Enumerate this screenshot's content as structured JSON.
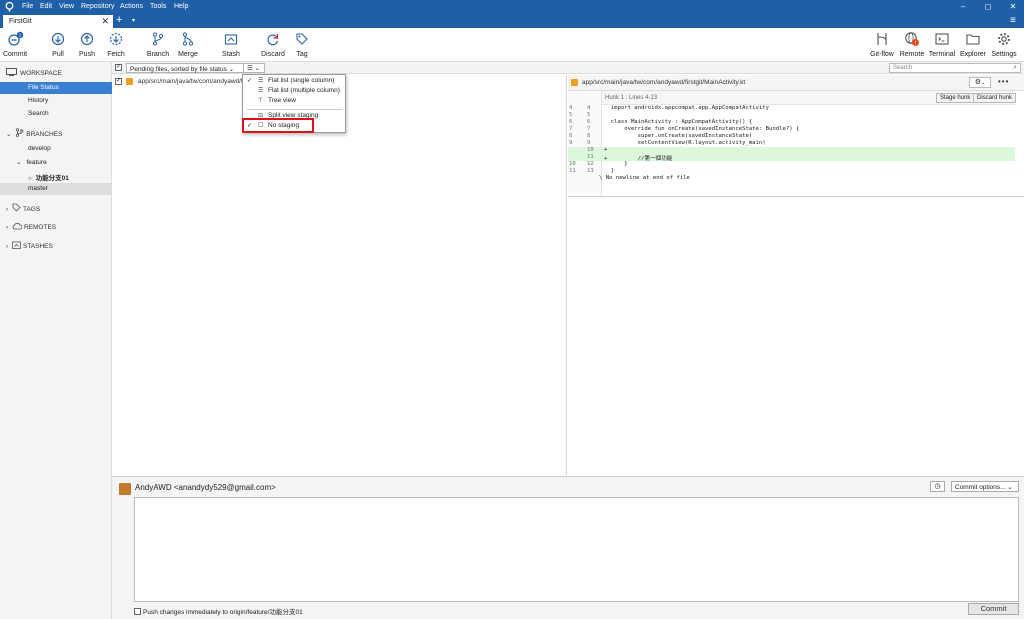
{
  "menubar": {
    "items": [
      "File",
      "Edit",
      "View",
      "Repository",
      "Actions",
      "Tools",
      "Help"
    ],
    "window_controls": [
      "–",
      "◻",
      "✕"
    ]
  },
  "tabs": {
    "active": "FirstGit",
    "close": "✕",
    "new": "+",
    "dropdown": "▾",
    "hamburger": "≡"
  },
  "toolbar": {
    "commit": "Commit",
    "commit_badge": "1",
    "pull": "Pull",
    "push": "Push",
    "fetch": "Fetch",
    "branch": "Branch",
    "merge": "Merge",
    "stash": "Stash",
    "discard": "Discard",
    "tag": "Tag",
    "gitflow": "Git-flow",
    "remote": "Remote",
    "remote_badge": "!",
    "terminal": "Terminal",
    "explorer": "Explorer",
    "settings": "Settings"
  },
  "search": {
    "placeholder": "Search"
  },
  "sidebar": {
    "workspace": "WORKSPACE",
    "file_status": "File Status",
    "history": "History",
    "search": "Search",
    "branches": "BRANCHES",
    "develop": "develop",
    "feature": "feature",
    "feature_branch": "功能分支01",
    "master": "master",
    "tags": "TAGS",
    "remotes": "REMOTES",
    "stashes": "STASHES"
  },
  "filterbar": {
    "sort_label": "Pending files, sorted by file status",
    "view_icon": "☰"
  },
  "view_menu": {
    "items": [
      {
        "label": "Flat list (single column)",
        "checked": true
      },
      {
        "label": "Flat list (multiple column)",
        "checked": false
      },
      {
        "label": "Tree view",
        "checked": false
      },
      {
        "label": "Split view staging",
        "checked": false
      },
      {
        "label": "No staging",
        "checked": true
      }
    ]
  },
  "files": [
    {
      "path": "app/src/main/java/tw/com/andyawd/firstgit/MainActivity.kt",
      "status": "modified"
    }
  ],
  "diff": {
    "file_path": "app/src/main/java/tw/com/andyawd/firstgit/MainActivity.kt",
    "hunk_label": "Hunk 1 : Lines 4-13",
    "stage_hunk": "Stage hunk",
    "discard_hunk": "Discard hunk",
    "lines": [
      {
        "old": "4",
        "new": "4",
        "text": "  import androidx.appcompat.app.AppCompatActivity",
        "type": "ctx"
      },
      {
        "old": "5",
        "new": "5",
        "text": "",
        "type": "ctx"
      },
      {
        "old": "6",
        "new": "6",
        "text": "  class MainActivity : AppCompatActivity() {",
        "type": "ctx"
      },
      {
        "old": "7",
        "new": "7",
        "text": "      override fun onCreate(savedInstanceState: Bundle?) {",
        "type": "ctx"
      },
      {
        "old": "8",
        "new": "8",
        "text": "          super.onCreate(savedInstanceState)",
        "type": "ctx"
      },
      {
        "old": "9",
        "new": "9",
        "text": "          setContentView(R.layout.activity_main)",
        "type": "ctx"
      },
      {
        "old": "",
        "new": "10",
        "text": "+",
        "type": "add"
      },
      {
        "old": "",
        "new": "11",
        "text": "+         //第一個功能",
        "type": "add"
      },
      {
        "old": "10",
        "new": "12",
        "text": "      }",
        "type": "ctx"
      },
      {
        "old": "11",
        "new": "13",
        "text": "  }",
        "type": "ctx"
      },
      {
        "old": "",
        "new": "",
        "text": "\\ No newline at end of file",
        "type": "ctx"
      }
    ]
  },
  "commit": {
    "author": "AndyAWD <anandydy529@gmail.com>",
    "options": "Commit options...",
    "push_label": "Push changes immediately to origin/feature/功能分支01",
    "commit_button": "Commit"
  },
  "colors": {
    "titlebar": "#1f5fa8",
    "selection": "#3b7fd4",
    "highlight_box": "#e0101a",
    "added_line": "#dcf7dc"
  }
}
